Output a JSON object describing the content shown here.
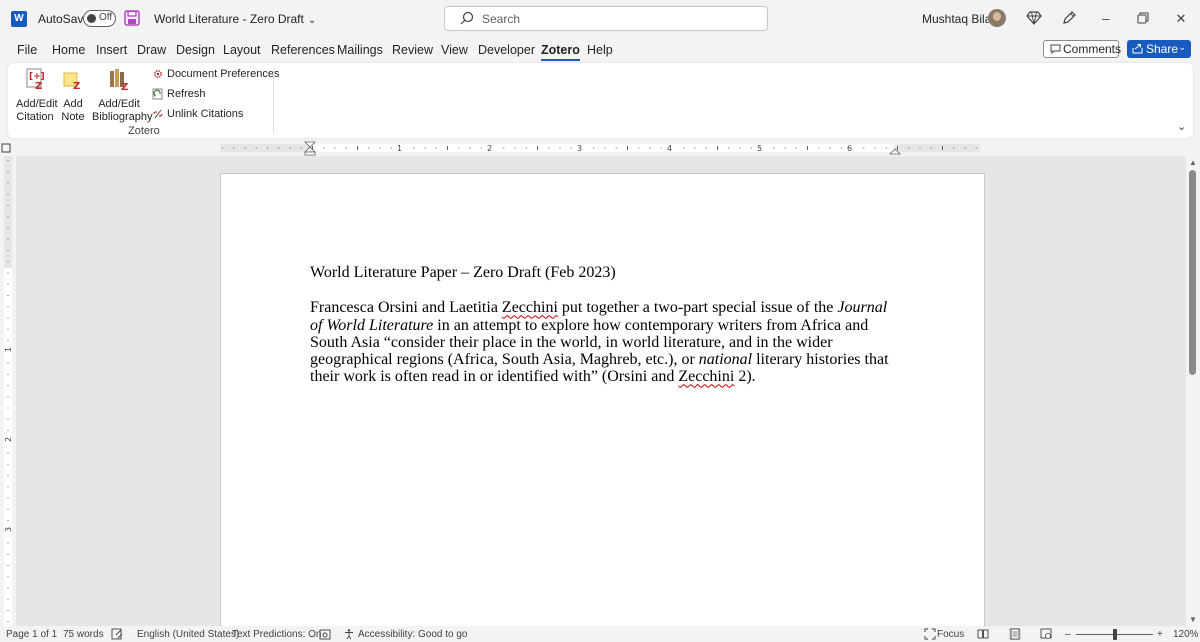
{
  "titlebar": {
    "app_icon": "word-icon",
    "app_letter": "W",
    "autosave_label": "AutoSave",
    "autosave_state": "Off",
    "document_title": "World Literature - Zero Draft",
    "search_placeholder": "Search",
    "user_name": "Mushtaq Bilal"
  },
  "menu": {
    "tabs": [
      "File",
      "Home",
      "Insert",
      "Draw",
      "Design",
      "Layout",
      "References",
      "Mailings",
      "Review",
      "View",
      "Developer",
      "Zotero",
      "Help"
    ],
    "active_tab": "Zotero",
    "comments_label": "Comments",
    "share_label": "Share"
  },
  "ribbon": {
    "buttons": [
      {
        "line1": "Add/Edit",
        "line2": "Citation",
        "icon": "zotero-citation-icon"
      },
      {
        "line1": "Add",
        "line2": "Note",
        "icon": "zotero-note-icon"
      },
      {
        "line1": "Add/Edit",
        "line2": "Bibliography",
        "icon": "zotero-bibliography-icon"
      }
    ],
    "small_buttons": [
      {
        "label": "Document Preferences",
        "icon": "gear-icon"
      },
      {
        "label": "Refresh",
        "icon": "refresh-icon"
      },
      {
        "label": "Unlink Citations",
        "icon": "unlink-icon"
      }
    ],
    "group_label": "Zotero"
  },
  "ruler": {
    "labels": [
      "1",
      "2",
      "3",
      "4",
      "5",
      "6"
    ]
  },
  "vruler": {
    "labels": [
      "1",
      "2",
      "3"
    ]
  },
  "document": {
    "heading": "World Literature Paper – Zero Draft (Feb 2023)",
    "p_part1": "Francesca Orsini and Laetitia ",
    "p_squiggle1": "Zecchini",
    "p_part2": " put together a two-part special issue of the ",
    "p_italic1": "Journal of World Literature",
    "p_part3": " in an attempt to explore how contemporary writers from Africa and South Asia “consider their place in the world, in world literature, and in the wider geographical regions (Africa, South Asia, Maghreb, etc.), or ",
    "p_italic2": "national",
    "p_part4": " literary histories that their work is often read in or identified with” (Orsini and ",
    "p_squiggle2": "Zecchini",
    "p_part5": " 2)."
  },
  "statusbar": {
    "page": "Page 1 of 1",
    "words": "75 words",
    "language": "English (United States)",
    "text_predictions": "Text Predictions: On",
    "accessibility": "Accessibility: Good to go",
    "focus": "Focus",
    "zoom_minus": "–",
    "zoom_plus": "+",
    "zoom": "120%"
  },
  "colors": {
    "accent": "#185abd",
    "spelling_error": "#c00000"
  }
}
